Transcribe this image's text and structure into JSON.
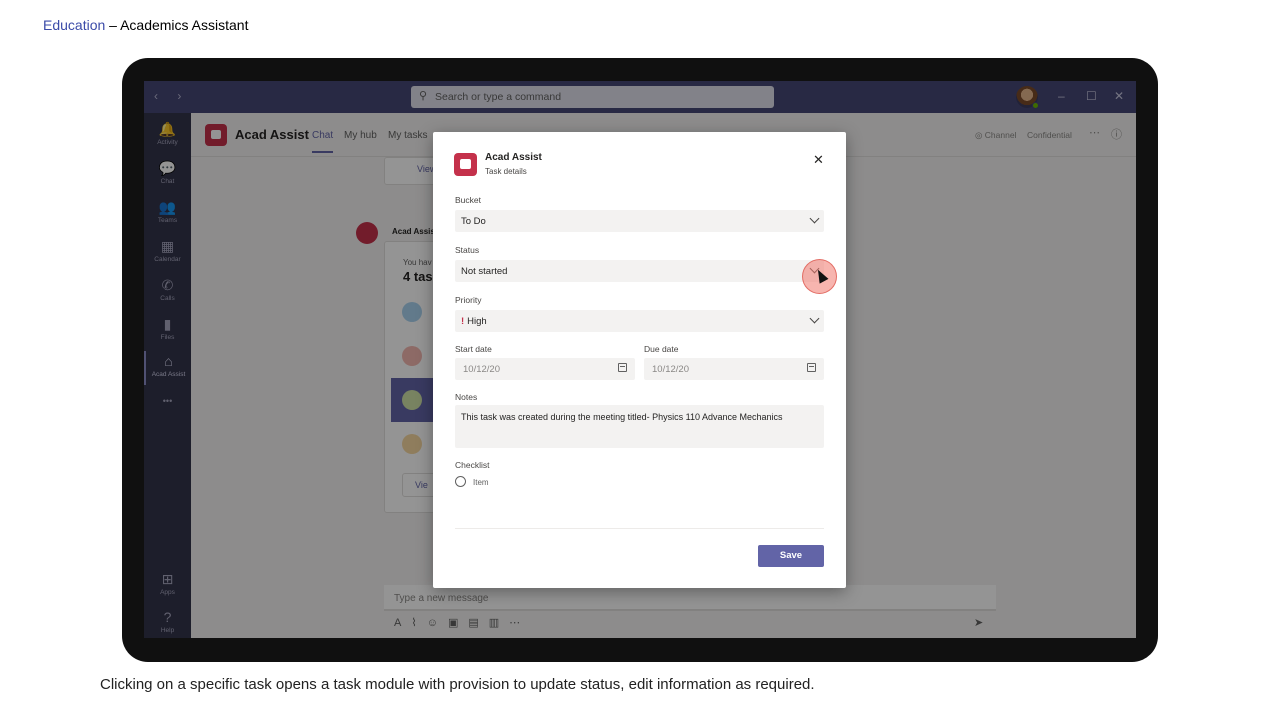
{
  "slide": {
    "title_prefix": "Education",
    "title_rest": " – Academics Assistant",
    "caption": "Clicking on a specific task opens a task module with provision to update status, edit information as required."
  },
  "teams": {
    "search_placeholder": "Search or type a command",
    "rail": [
      {
        "icon": "bell-icon",
        "glyph": "🔔",
        "label": "Activity"
      },
      {
        "icon": "chat-icon",
        "glyph": "💬",
        "label": "Chat"
      },
      {
        "icon": "teams-icon",
        "glyph": "👥",
        "label": "Teams"
      },
      {
        "icon": "calendar-icon",
        "glyph": "▦",
        "label": "Calendar"
      },
      {
        "icon": "phone-icon",
        "glyph": "✆",
        "label": "Calls"
      },
      {
        "icon": "files-icon",
        "glyph": "▮",
        "label": "Files"
      },
      {
        "icon": "acad-assist-icon",
        "glyph": "⌂",
        "label": "Acad Assist"
      },
      {
        "icon": "more-icon",
        "glyph": "•••",
        "label": ""
      },
      {
        "icon": "apps-icon",
        "glyph": "⊞",
        "label": "Apps"
      },
      {
        "icon": "help-icon",
        "glyph": "?",
        "label": "Help"
      }
    ],
    "app_name": "Acad Assist",
    "tabs": [
      "Chat",
      "My hub",
      "My tasks"
    ],
    "header_right": {
      "channel": "Channel",
      "confidential": "Confidential"
    },
    "chat": {
      "bot_name": "Acad Assis",
      "card_intro": "You hav",
      "card_count": "4 tas",
      "view_label": "View",
      "view_label_2": "Vie"
    },
    "message_placeholder": "Type a new message"
  },
  "dialog": {
    "title": "Acad Assist",
    "subtitle": "Task details",
    "bucket_label": "Bucket",
    "bucket_value": "To Do",
    "status_label": "Status",
    "status_value": "Not started",
    "priority_label": "Priority",
    "priority_mark": "!",
    "priority_value": "High",
    "start_label": "Start date",
    "start_value": "10/12/20",
    "due_label": "Due date",
    "due_value": "10/12/20",
    "notes_label": "Notes",
    "notes_value": "This task was created during the meeting  titled- Physics 110 Advance Mechanics",
    "checklist_label": "Checklist",
    "checklist_item": "Item",
    "save_label": "Save"
  },
  "colors": {
    "accent": "#6264a7",
    "app_red": "#c4314b",
    "titlebar": "#464775",
    "rail": "#33344a"
  }
}
